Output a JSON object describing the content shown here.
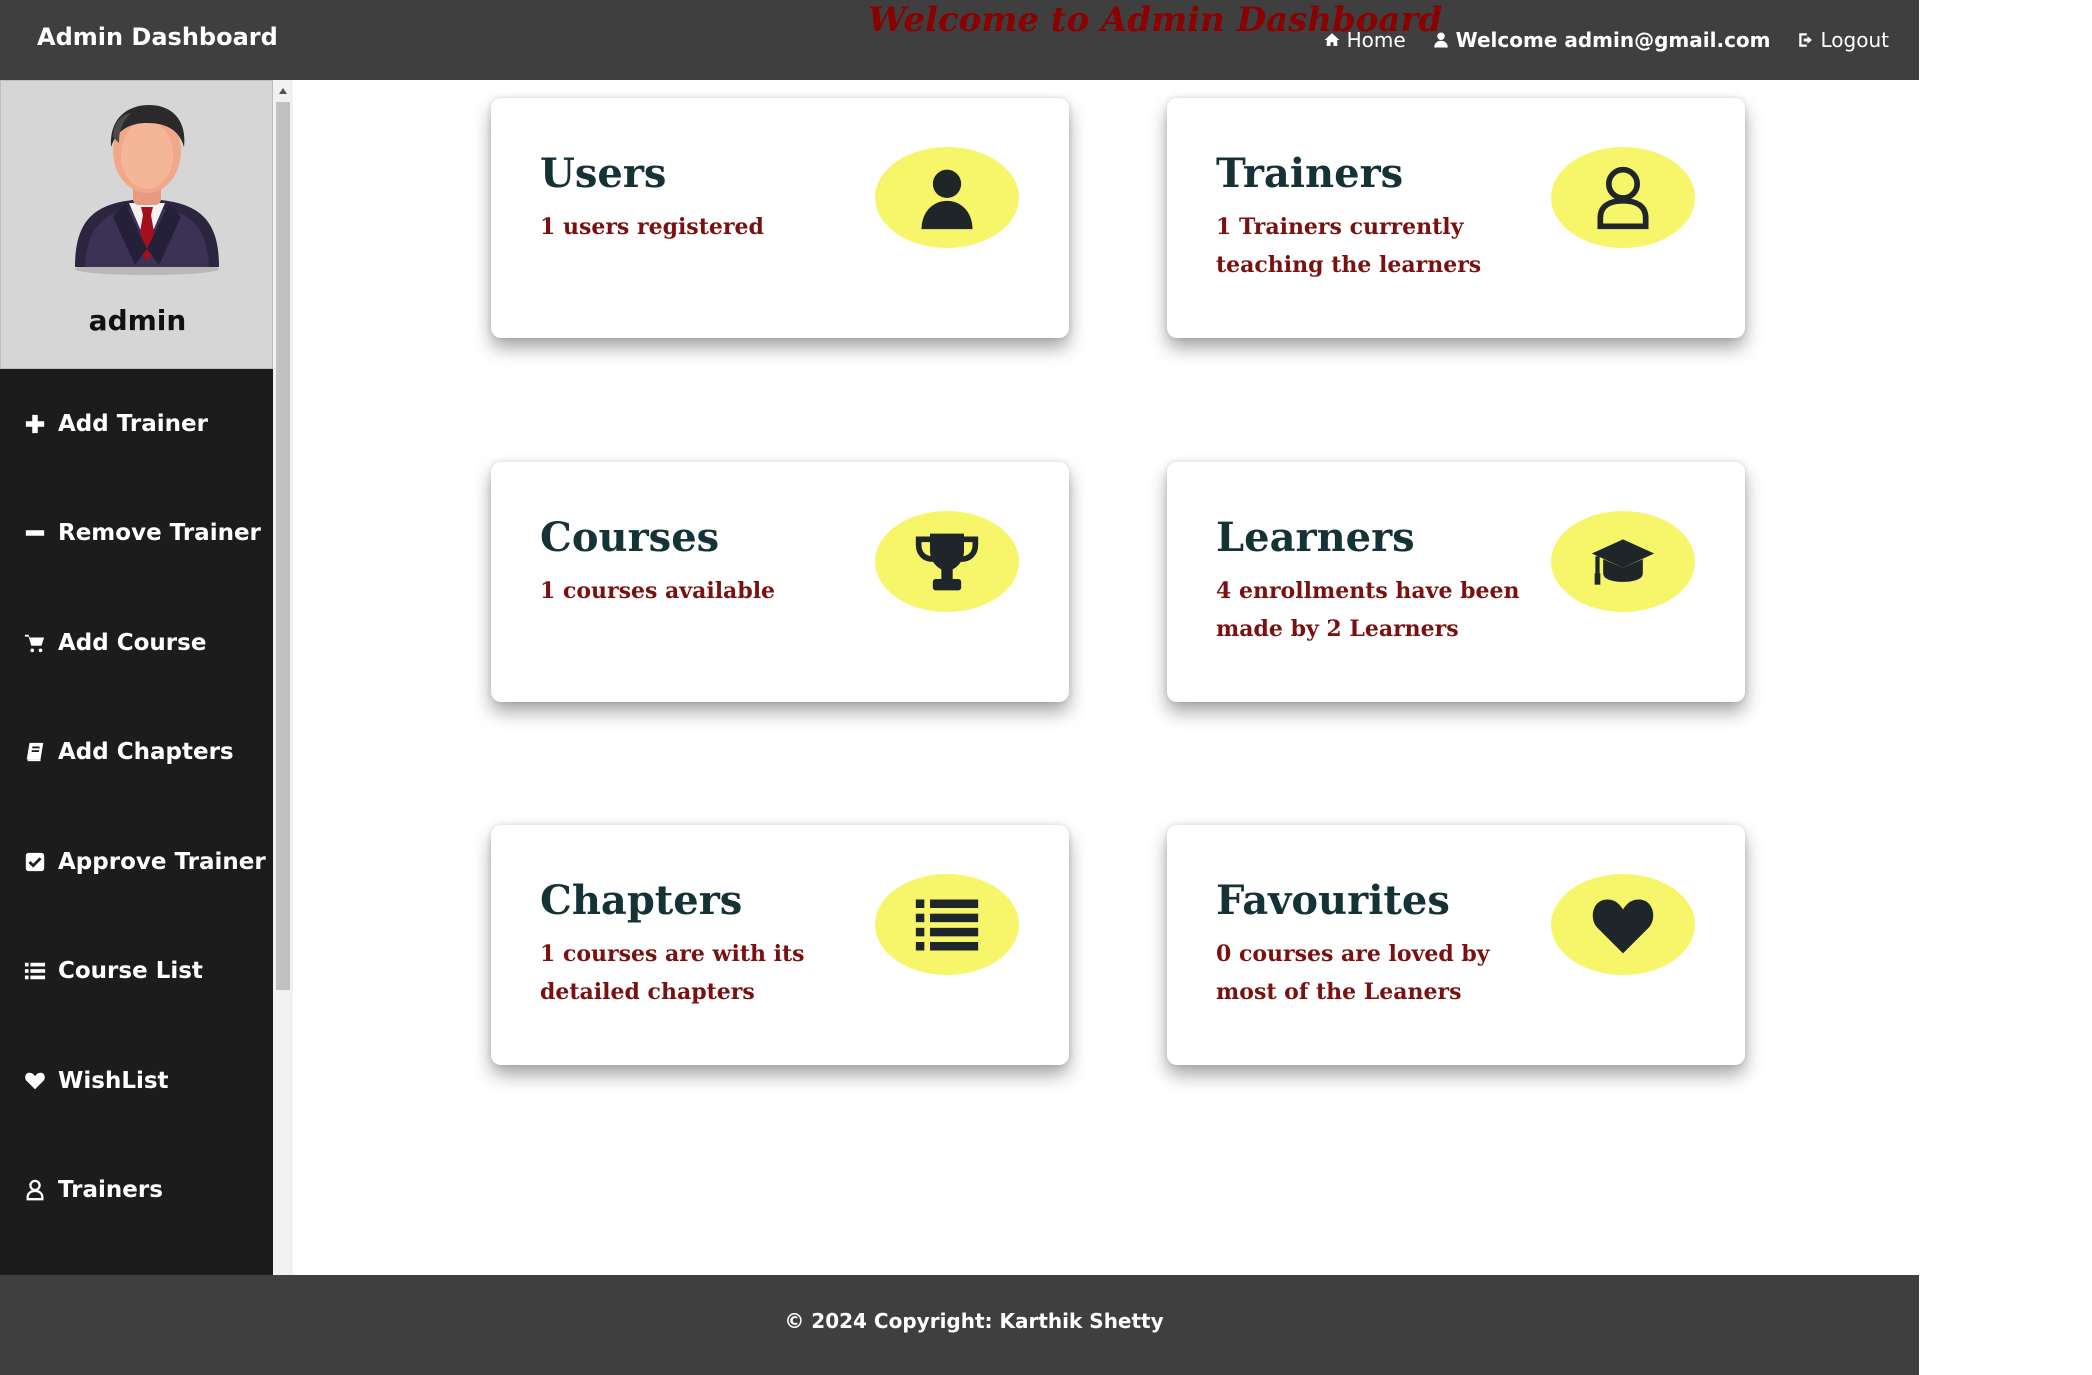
{
  "header": {
    "brand": "Admin Dashboard",
    "title": "Welcome to Admin Dashboard",
    "nav": {
      "home": "Home",
      "welcome": "Welcome admin@gmail.com",
      "logout": "Logout"
    }
  },
  "sidebar": {
    "profile_name": "admin",
    "items": [
      {
        "label": "Add Trainer",
        "icon": "plus-icon"
      },
      {
        "label": "Remove Trainer",
        "icon": "minus-icon"
      },
      {
        "label": "Add Course",
        "icon": "cart-icon"
      },
      {
        "label": "Add Chapters",
        "icon": "book-icon"
      },
      {
        "label": "Approve Trainer",
        "icon": "check-square-icon"
      },
      {
        "label": "Course List",
        "icon": "list-icon"
      },
      {
        "label": "WishList",
        "icon": "heart-icon"
      },
      {
        "label": "Trainers",
        "icon": "user-outline-icon"
      }
    ]
  },
  "cards": [
    {
      "title": "Users",
      "text": "1 users registered",
      "icon": "user-icon"
    },
    {
      "title": "Trainers",
      "text": "1 Trainers currently teaching the learners",
      "icon": "user-outline-icon"
    },
    {
      "title": "Courses",
      "text": "1 courses available",
      "icon": "trophy-icon"
    },
    {
      "title": "Learners",
      "text": "4 enrollments have been made by 2 Learners",
      "icon": "graduation-cap-icon"
    },
    {
      "title": "Chapters",
      "text": "1 courses are with its detailed chapters",
      "icon": "list-icon"
    },
    {
      "title": "Favourites",
      "text": "0 courses are loved by most of the Leaners",
      "icon": "heart-icon"
    }
  ],
  "footer": {
    "prefix": "© 2024 Copyright:",
    "author": "Karthik Shetty"
  },
  "colors": {
    "topbar": "#3f3f3f",
    "sidebar": "#1c1c1c",
    "title_red": "#8b0000",
    "card_heading": "#153236",
    "card_text": "#7a1010",
    "badge": "#f7f56a"
  }
}
